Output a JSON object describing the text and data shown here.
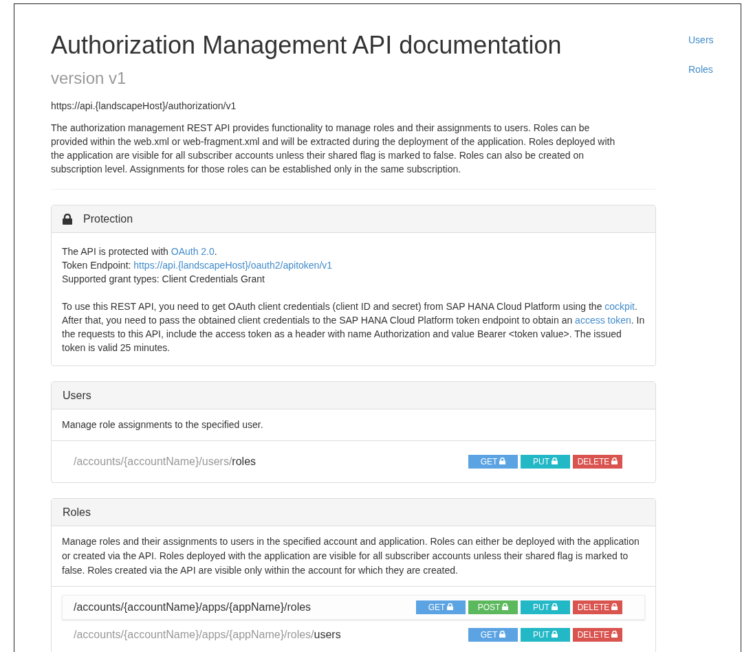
{
  "title": "Authorization Management API documentation",
  "version": "version v1",
  "base_url": "https://api.{landscapeHost}/authorization/v1",
  "description": "The authorization management REST API provides functionality to manage roles and their assignments to users. Roles can be provided within the web.xml or web-fragment.xml and will be extracted during the deployment of the application. Roles deployed with the application are visible for all subscriber accounts unless their shared flag is marked to false. Roles can also be created on subscription level. Assignments for those roles can be established only in the same subscription.",
  "nav": [
    {
      "label": "Users"
    },
    {
      "label": "Roles"
    }
  ],
  "protection": {
    "title": "Protection",
    "paragraphs": [
      [
        [
          {
            "text": "The API is protected with ",
            "link": false
          },
          {
            "text": "OAuth 2.0",
            "link": true
          },
          {
            "text": ".",
            "link": false
          }
        ],
        [
          {
            "text": "Token Endpoint: ",
            "link": false
          },
          {
            "text": "https://api.{landscapeHost}/oauth2/apitoken/v1",
            "link": true
          }
        ],
        [
          {
            "text": "Supported grant types: Client Credentials Grant",
            "link": false
          }
        ]
      ],
      [
        [
          {
            "text": "To use this REST API, you need to get OAuth client credentials (client ID and secret) from SAP HANA Cloud Platform using the ",
            "link": false
          },
          {
            "text": "cockpit",
            "link": true
          },
          {
            "text": ". After that, you need to pass the obtained client credentials to the SAP HANA Cloud Platform token endpoint to obtain an ",
            "link": false
          },
          {
            "text": "access token",
            "link": true
          },
          {
            "text": ". In the requests to this API, include the access token as a header with name Authorization and value Bearer <token value>. The issued token is valid 25 minutes.",
            "link": false
          }
        ]
      ]
    ]
  },
  "sections": [
    {
      "title": "Users",
      "description": "Manage role assignments to the specified user.",
      "resources": [
        {
          "highlighted": false,
          "path": [
            {
              "text": "/accounts/{accountName}/users/",
              "muted": true
            },
            {
              "text": "roles",
              "muted": false
            }
          ],
          "methods": [
            {
              "kind": "get",
              "label": "GET"
            },
            {
              "kind": "put",
              "label": "PUT"
            },
            {
              "kind": "delete",
              "label": "DELETE"
            }
          ]
        }
      ]
    },
    {
      "title": "Roles",
      "description": "Manage roles and their assignments to users in the specified account and application. Roles can either be deployed with the application or created via the API. Roles deployed with the application are visible for all subscriber accounts unless their shared flag is marked to false. Roles created via the API are visible only within the account for which they are created.",
      "resources": [
        {
          "highlighted": true,
          "path": [
            {
              "text": "/accounts/{accountName}/apps/{appName}/roles",
              "muted": false
            }
          ],
          "methods": [
            {
              "kind": "get",
              "label": "GET"
            },
            {
              "kind": "post",
              "label": "POST"
            },
            {
              "kind": "put",
              "label": "PUT"
            },
            {
              "kind": "delete",
              "label": "DELETE"
            }
          ]
        },
        {
          "highlighted": false,
          "path": [
            {
              "text": "/accounts/{accountName}/apps/{appName}/roles/",
              "muted": true
            },
            {
              "text": "users",
              "muted": false
            }
          ],
          "methods": [
            {
              "kind": "get",
              "label": "GET"
            },
            {
              "kind": "put",
              "label": "PUT"
            },
            {
              "kind": "delete",
              "label": "DELETE"
            }
          ]
        }
      ]
    }
  ]
}
